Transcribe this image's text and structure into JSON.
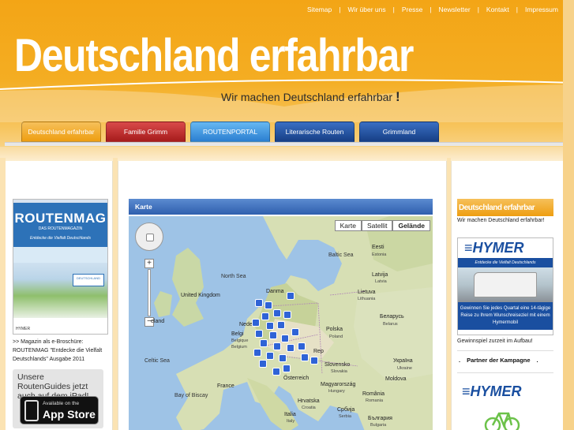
{
  "topnav": {
    "items": [
      "Sitemap",
      "Wir über uns",
      "Presse",
      "Newsletter",
      "Kontakt",
      "Impressum"
    ]
  },
  "site": {
    "title": "Deutschland erfahrbar",
    "tagline": "Wir machen Deutschland erfahrbar",
    "tagline_excl": "!"
  },
  "tabs": [
    "Deutschland erfahrbar",
    "Familie Grimm",
    "ROUTENPORTAL",
    "Literarische Routen",
    "Grimmland"
  ],
  "left": {
    "magazine": {
      "title": "ROUTENMAG",
      "subtitle": "DAS ROUTENMAGAZIN",
      "claim": "Entdecke die Vielfalt Deutschlands",
      "badge": "DEUTSCHLAND",
      "footer": "HYMER"
    },
    "caption": ">> Magazin als e-Broschüre: ROUTENMAG \"Entdecke die Vielfalt Deutschlands\" Ausgabe 2011",
    "appstore": {
      "title": "Unsere RoutenGuides jetzt auch auf dem iPad!",
      "badge_line1": "Available on the",
      "badge_line2": "App Store"
    }
  },
  "map": {
    "header": "Karte",
    "types": [
      "Karte",
      "Satellit",
      "Gelände"
    ],
    "active_type": "Gelände",
    "zoom_plus": "+",
    "zoom_minus": "−",
    "labels": {
      "north_sea": "North Sea",
      "baltic_sea": "Baltic Sea",
      "estonia": "Eesti",
      "estonia_en": "Estonia",
      "latvia": "Latvija",
      "latvia_en": "Latvia",
      "lithuania": "Lietuva",
      "lithuania_en": "Lithuania",
      "belarus": "Беларусь",
      "belarus_en": "Belarus",
      "denmark": "Danma",
      "uk": "United Kingdom",
      "ireland": "eland",
      "netherlands": "Nede",
      "belgium": "Belgi",
      "belgium_fr": "Belgique",
      "belgium_en": "Belgium",
      "poland": "Polska",
      "poland_en": "Poland",
      "celtic_sea": "Celtic Sea",
      "czech": "Rep",
      "ukraine": "Україна",
      "ukraine_en": "Ukraine",
      "slovakia": "Slovensko",
      "slovakia_en": "Slovakia",
      "france": "France",
      "austria": "Österreich",
      "hungary": "Magyarország",
      "hungary_en": "Hungary",
      "moldova": "Moldova",
      "bay_biscay": "Bay of Biscay",
      "croatia": "Hrvatska",
      "croatia_en": "Croatia",
      "serbia": "Србија",
      "serbia_en": "Serbia",
      "romania": "România",
      "romania_en": "Romania",
      "italy": "Italia",
      "italy_en": "Italy",
      "bulgaria": "България",
      "bulgaria_en": "Bulgaria"
    }
  },
  "right": {
    "banner": "Deutschland erfahrbar",
    "banner_sub": "Wir machen Deutschland erfahrbar!",
    "hymer": {
      "logo": "≡HYMER",
      "claim": "Entdecke die Vielfalt Deutschlands",
      "text": "Gewinnen Sie jedes Quartal eine 14-tägige Reise zu Ihrem Wunschreiseziel mit einem Hymermobil"
    },
    "gewinn": "Gewinnspiel zurzeit im Aufbau!",
    "partner": "Partner der Kampagne",
    "partner_dot": ".",
    "hymer_logo2": "≡HYMER"
  },
  "colors": {
    "header_orange": "#f3a516",
    "tab_orange": "#ee9e11",
    "tab_red": "#a71c1c",
    "tab_lightblue": "#2b7fd1",
    "tab_darkblue": "#173f86",
    "map_water": "#9ec3e6",
    "pin_blue": "#2f63d6",
    "hymer_blue": "#1a4fa0"
  }
}
